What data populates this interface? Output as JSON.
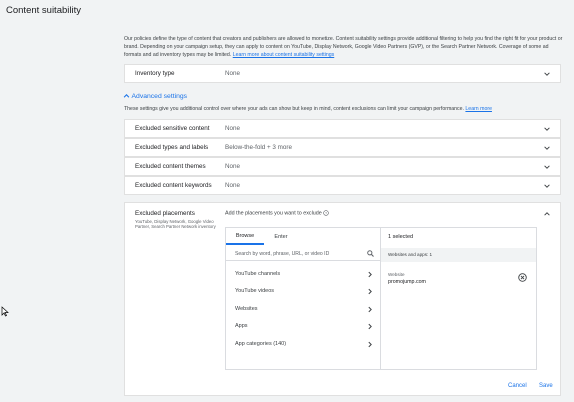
{
  "page_title": "Content suitability",
  "intro": {
    "text": "Our policies define the type of content that creators and publishers are allowed to monetize. Content suitability settings provide additional filtering to help you find the right fit for your product or brand. Depending on your campaign setup, they can apply to content on YouTube, Display Network, Google Video Partners (GVP), or the Search Partner Network. Coverage of some ad formats and ad inventory types may be limited.",
    "link": "Learn more about content suitability settings"
  },
  "inventory": {
    "label": "Inventory type",
    "value": "None"
  },
  "advanced": {
    "label": "Advanced settings",
    "subtext": "These settings give you additional control over where your ads can show but keep in mind, content exclusions can limit your campaign performance.",
    "link": "Learn more"
  },
  "rows": [
    {
      "label": "Excluded sensitive content",
      "value": "None"
    },
    {
      "label": "Excluded types and labels",
      "value": "Below-the-fold + 3 more"
    },
    {
      "label": "Excluded content themes",
      "value": "None"
    },
    {
      "label": "Excluded content keywords",
      "value": "None"
    }
  ],
  "placements": {
    "title": "Excluded placements",
    "description": "YouTube, Display Network, Google Video Partner, Search Partner Network inventory",
    "add_label": "Add the placements you want to exclude",
    "tabs": [
      "Browse",
      "Enter"
    ],
    "active_tab": "Browse",
    "search_placeholder": "Search by word, phrase, URL, or video ID",
    "browse_items": [
      "YouTube channels",
      "YouTube videos",
      "Websites",
      "Apps",
      "App categories (140)"
    ],
    "selected_count": "1 selected",
    "group_header": "Websites and apps: 1",
    "selected_item": {
      "type": "Website",
      "value": "promojump.com"
    }
  },
  "actions": {
    "cancel": "Cancel",
    "save": "Save"
  },
  "colors": {
    "accent": "#1a73e8",
    "background": "#f1f3f4"
  }
}
